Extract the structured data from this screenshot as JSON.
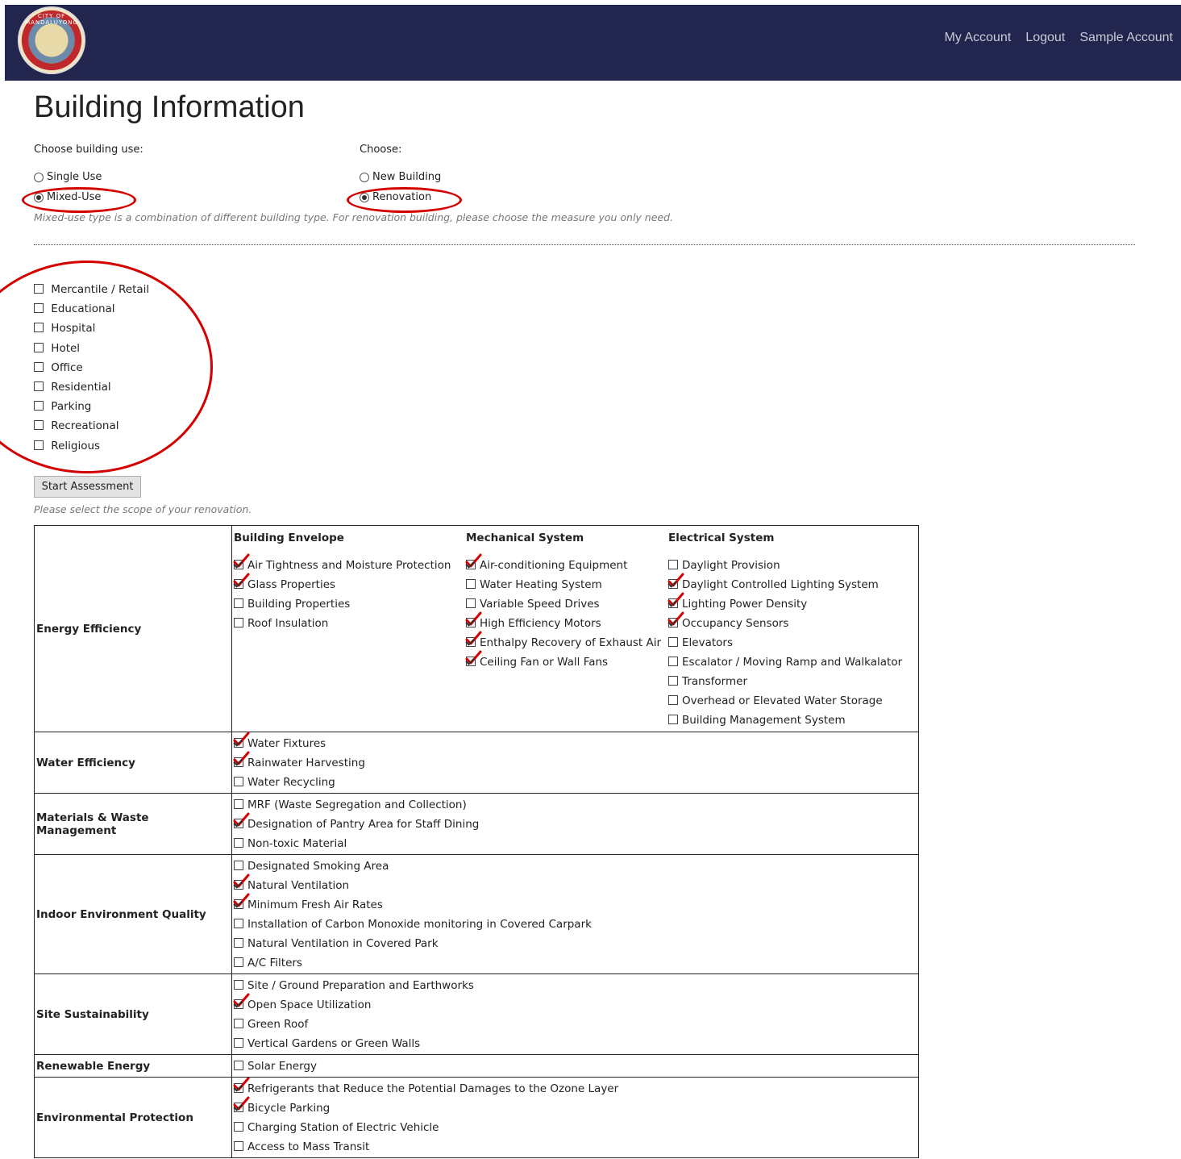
{
  "header": {
    "logo_text": "CITY OF MANDALUYONG",
    "nav": [
      "My Account",
      "Logout",
      "Sample Account"
    ]
  },
  "page_title": "Building Information",
  "building_use": {
    "label": "Choose building use:",
    "options": [
      {
        "label": "Single Use",
        "selected": false
      },
      {
        "label": "Mixed-Use",
        "selected": true
      }
    ]
  },
  "build_type": {
    "label": "Choose:",
    "options": [
      {
        "label": "New Building",
        "selected": false
      },
      {
        "label": "Renovation",
        "selected": true
      }
    ]
  },
  "note": "Mixed-use type is a combination of different building type. For renovation building, please choose the measure you only need.",
  "use_types": [
    "Mercantile / Retail",
    "Educational",
    "Hospital",
    "Hotel",
    "Office",
    "Residential",
    "Parking",
    "Recreational",
    "Religious"
  ],
  "start_button": "Start Assessment",
  "scope_note": "Please select the scope of your renovation.",
  "annotation_color": "#d40000",
  "energy": {
    "label": "Energy Efficiency",
    "columns": [
      {
        "title": "Building Envelope",
        "items": [
          {
            "label": "Air Tightness and Moisture Protection",
            "checked": true
          },
          {
            "label": "Glass Properties",
            "checked": true
          },
          {
            "label": "Building Properties",
            "checked": false
          },
          {
            "label": "Roof Insulation",
            "checked": false
          }
        ]
      },
      {
        "title": "Mechanical System",
        "items": [
          {
            "label": "Air-conditioning Equipment",
            "checked": true
          },
          {
            "label": "Water Heating System",
            "checked": false
          },
          {
            "label": "Variable Speed Drives",
            "checked": false
          },
          {
            "label": "High Efficiency Motors",
            "checked": true
          },
          {
            "label": "Enthalpy Recovery of Exhaust Air",
            "checked": true
          },
          {
            "label": "Ceiling Fan or Wall Fans",
            "checked": true
          }
        ]
      },
      {
        "title": "Electrical System",
        "items": [
          {
            "label": "Daylight Provision",
            "checked": false
          },
          {
            "label": "Daylight Controlled Lighting System",
            "checked": true
          },
          {
            "label": "Lighting Power Density",
            "checked": true
          },
          {
            "label": "Occupancy Sensors",
            "checked": true
          },
          {
            "label": "Elevators",
            "checked": false
          },
          {
            "label": "Escalator / Moving Ramp and Walkalator",
            "checked": false
          },
          {
            "label": "Transformer",
            "checked": false
          },
          {
            "label": "Overhead or Elevated Water Storage",
            "checked": false
          },
          {
            "label": "Building Management System",
            "checked": false
          }
        ]
      }
    ]
  },
  "categories": [
    {
      "label": "Water Efficiency",
      "items": [
        {
          "label": "Water Fixtures",
          "checked": true
        },
        {
          "label": "Rainwater Harvesting",
          "checked": true
        },
        {
          "label": "Water Recycling",
          "checked": false
        }
      ]
    },
    {
      "label": "Materials & Waste Management",
      "items": [
        {
          "label": "MRF (Waste Segregation and Collection)",
          "checked": false
        },
        {
          "label": "Designation of Pantry Area for Staff Dining",
          "checked": true
        },
        {
          "label": "Non-toxic Material",
          "checked": false
        }
      ]
    },
    {
      "label": "Indoor Environment Quality",
      "items": [
        {
          "label": "Designated Smoking Area",
          "checked": false
        },
        {
          "label": "Natural Ventilation",
          "checked": true
        },
        {
          "label": "Minimum Fresh Air Rates",
          "checked": true
        },
        {
          "label": "Installation of Carbon Monoxide monitoring in Covered Carpark",
          "checked": false
        },
        {
          "label": "Natural Ventilation in Covered Park",
          "checked": false
        },
        {
          "label": "A/C Filters",
          "checked": false
        }
      ]
    },
    {
      "label": "Site Sustainability",
      "items": [
        {
          "label": "Site / Ground Preparation and Earthworks",
          "checked": false
        },
        {
          "label": "Open Space Utilization",
          "checked": true
        },
        {
          "label": "Green Roof",
          "checked": false
        },
        {
          "label": "Vertical Gardens or Green Walls",
          "checked": false
        }
      ]
    },
    {
      "label": "Renewable Energy",
      "items": [
        {
          "label": "Solar Energy",
          "checked": false
        }
      ]
    },
    {
      "label": "Environmental Protection",
      "items": [
        {
          "label": "Refrigerants that Reduce the Potential Damages to the Ozone Layer",
          "checked": true
        },
        {
          "label": "Bicycle Parking",
          "checked": true
        },
        {
          "label": "Charging Station of Electric Vehicle",
          "checked": false
        },
        {
          "label": "Access to Mass Transit",
          "checked": false
        }
      ]
    }
  ]
}
